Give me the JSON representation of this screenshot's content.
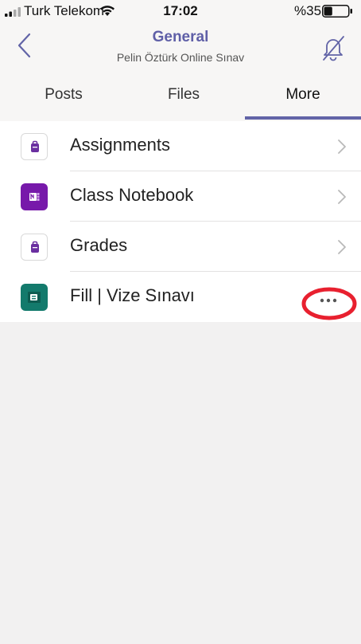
{
  "status_bar": {
    "carrier": "Turk Telekom",
    "time": "17:02",
    "battery_percent": "%35",
    "battery_level": 0.35
  },
  "nav": {
    "title": "General",
    "subtitle": "Pelin Öztürk Online Sınav"
  },
  "tabs": [
    {
      "label": "Posts",
      "selected": false
    },
    {
      "label": "Files",
      "selected": false
    },
    {
      "label": "More",
      "selected": true
    }
  ],
  "list": {
    "items": [
      {
        "label": "Assignments",
        "icon": "assignments-icon",
        "chevron": true
      },
      {
        "label": "Class Notebook",
        "icon": "onenote-icon",
        "chevron": true
      },
      {
        "label": "Grades",
        "icon": "grades-icon",
        "chevron": true
      },
      {
        "label": "Fill | Vize Sınavı",
        "icon": "forms-icon",
        "chevron": false,
        "more": true
      }
    ]
  },
  "colors": {
    "accent": "#6264a7",
    "onenote": "#7719aa",
    "forms": "#137a6c",
    "highlight": "#e8202f"
  }
}
